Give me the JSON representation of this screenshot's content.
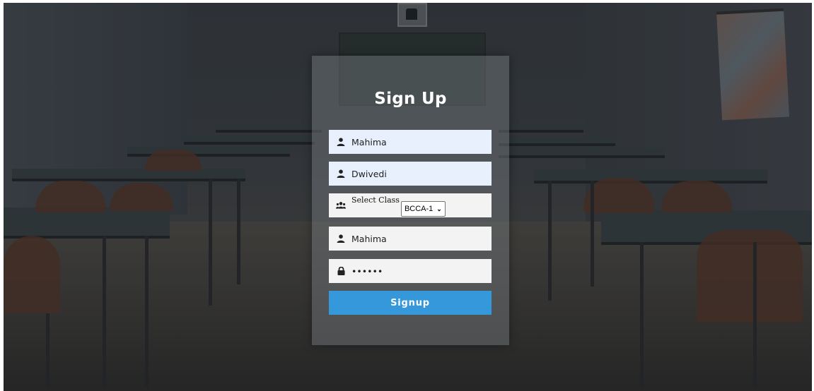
{
  "form": {
    "title": "Sign Up",
    "first_name": {
      "value": "Mahima",
      "icon": "user-icon"
    },
    "last_name": {
      "value": "Dwivedi",
      "icon": "user-icon"
    },
    "class_select": {
      "label": "Select Class",
      "selected": "BCCA-1",
      "icon": "users-icon"
    },
    "username": {
      "value": "Mahima",
      "icon": "user-icon"
    },
    "password": {
      "value": "••••••",
      "icon": "lock-icon"
    },
    "submit_label": "Signup"
  },
  "colors": {
    "button": "#3498db",
    "autofill_field": "#e8f0fe",
    "plain_field": "#f3f3f3"
  }
}
